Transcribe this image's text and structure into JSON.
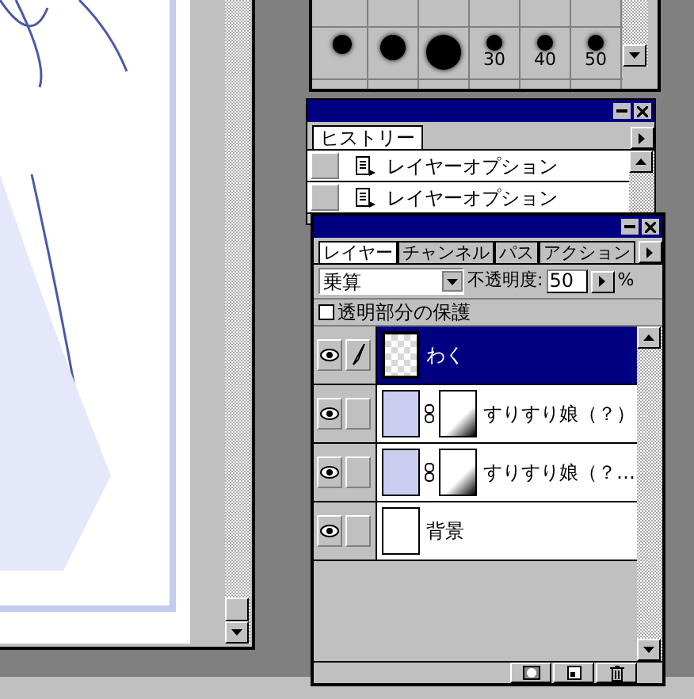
{
  "brushes": {
    "labels": [
      "30",
      "40",
      "50"
    ]
  },
  "history": {
    "tab": "ヒストリー",
    "items": [
      {
        "label": "レイヤーオプション"
      },
      {
        "label": "レイヤーオプション"
      }
    ]
  },
  "layers_panel": {
    "tabs": [
      {
        "label": "レイヤー",
        "selected": true
      },
      {
        "label": "チャンネル",
        "selected": false
      },
      {
        "label": "パス",
        "selected": false
      },
      {
        "label": "アクション",
        "selected": false
      }
    ],
    "blend_mode": "乗算",
    "opacity_label": "不透明度:",
    "opacity": "50",
    "percent": "%",
    "preserve_transparency": {
      "label": "透明部分の保護",
      "checked": false
    },
    "layers": [
      {
        "name": "わく",
        "kind": "transparent",
        "selected": true,
        "visible": true,
        "editing": true
      },
      {
        "name": "すりすり娘（？）",
        "kind": "masked",
        "selected": false,
        "visible": true,
        "editing": false
      },
      {
        "name": "すりすり娘（？…",
        "kind": "masked",
        "selected": false,
        "visible": true,
        "editing": false
      },
      {
        "name": "背景",
        "kind": "blank",
        "selected": false,
        "visible": true,
        "editing": false
      }
    ]
  }
}
